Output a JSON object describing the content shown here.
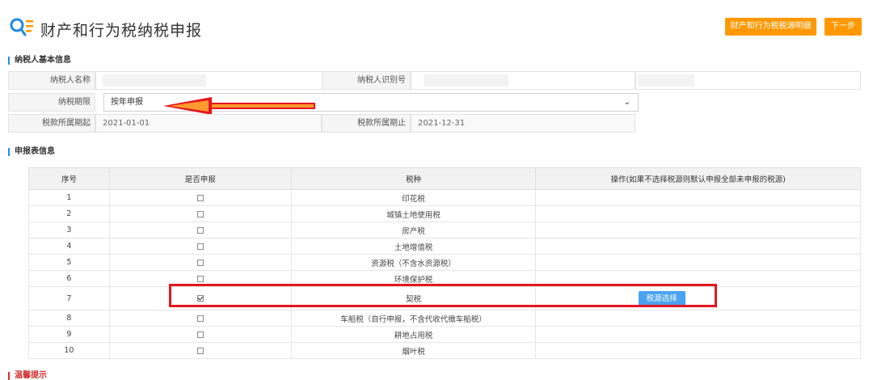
{
  "header": {
    "title": "财产和行为税纳税申报",
    "detail_button": "财产和行为税税源明细",
    "next_button": "下一步"
  },
  "basic": {
    "section_title": "纳税人基本信息",
    "taxpayer_name_label": "纳税人名称",
    "taxpayer_id_label": "纳税人识别号",
    "period_label": "纳税期限",
    "period_value": "按年申报",
    "start_label": "税款所属期起",
    "start_value": "2021-01-01",
    "end_label": "税款所属期止",
    "end_value": "2021-12-31"
  },
  "report": {
    "section_title": "申报表信息",
    "columns": [
      "序号",
      "是否申报",
      "税种",
      "操作(如果不选择税源则默认申报全部未申报的税源)"
    ],
    "rows": [
      {
        "no": "1",
        "checked": false,
        "tax": "印花税"
      },
      {
        "no": "2",
        "checked": false,
        "tax": "城镇土地使用税"
      },
      {
        "no": "3",
        "checked": false,
        "tax": "房产税"
      },
      {
        "no": "4",
        "checked": false,
        "tax": "土地增值税"
      },
      {
        "no": "5",
        "checked": false,
        "tax": "资源税（不含水资源税）"
      },
      {
        "no": "6",
        "checked": false,
        "tax": "环境保护税"
      },
      {
        "no": "7",
        "checked": true,
        "tax": "契税",
        "action": "税源选择"
      },
      {
        "no": "8",
        "checked": false,
        "tax": "车船税（自行申报，不含代收代缴车船税）"
      },
      {
        "no": "9",
        "checked": false,
        "tax": "耕地占用税"
      },
      {
        "no": "10",
        "checked": false,
        "tax": "烟叶税"
      }
    ]
  },
  "footer": {
    "section_title": "温馨提示"
  },
  "colors": {
    "accent_orange": "#ff9800",
    "accent_blue": "#4aa3f0",
    "highlight_red": "#e4161f"
  }
}
